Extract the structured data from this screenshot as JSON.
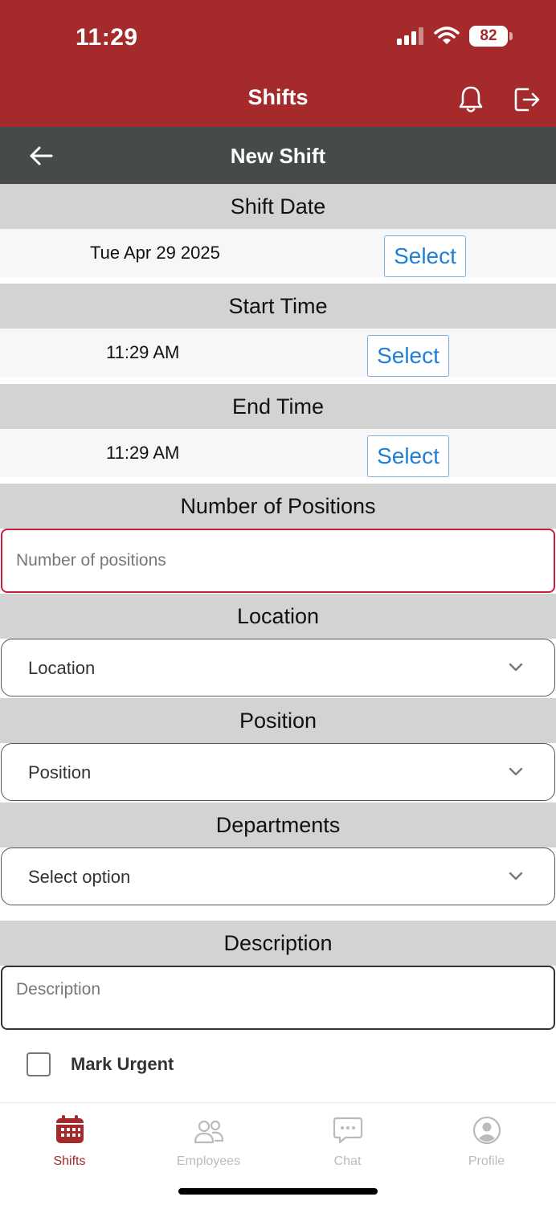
{
  "status": {
    "time": "11:29",
    "battery": "82"
  },
  "appbar": {
    "title": "Shifts"
  },
  "subbar": {
    "title": "New Shift"
  },
  "form": {
    "shift_date": {
      "label": "Shift Date",
      "value": "Tue Apr 29 2025",
      "button": "Select"
    },
    "start_time": {
      "label": "Start Time",
      "value": "11:29 AM",
      "button": "Select"
    },
    "end_time": {
      "label": "End Time",
      "value": "11:29 AM",
      "button": "Select"
    },
    "positions": {
      "label": "Number of Positions",
      "placeholder": "Number of positions",
      "value": ""
    },
    "location": {
      "label": "Location",
      "selected": "Location"
    },
    "position": {
      "label": "Position",
      "selected": "Position"
    },
    "departments": {
      "label": "Departments",
      "selected": "Select option"
    },
    "description": {
      "label": "Description",
      "placeholder": "Description",
      "value": ""
    },
    "urgent": {
      "label": "Mark Urgent",
      "checked": false
    }
  },
  "tabs": [
    {
      "label": "Shifts",
      "icon": "calendar-icon",
      "active": true
    },
    {
      "label": "Employees",
      "icon": "people-icon",
      "active": false
    },
    {
      "label": "Chat",
      "icon": "chat-icon",
      "active": false
    },
    {
      "label": "Profile",
      "icon": "profile-icon",
      "active": false
    }
  ],
  "colors": {
    "brand": "#a52a2c",
    "subbar": "#474a4a",
    "section": "#d3d3d3",
    "link": "#1f7fd6",
    "danger_border": "#c4203f"
  }
}
